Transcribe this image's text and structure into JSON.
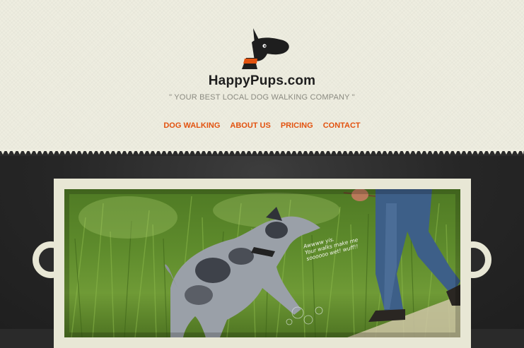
{
  "site": {
    "title": "HappyPups.com",
    "tagline": "\" YOUR BEST LOCAL DOG WALKING COMPANY \"",
    "logo_icon": "dog-head-icon"
  },
  "nav": {
    "items": [
      {
        "label": "DOG WALKING"
      },
      {
        "label": "ABOUT US"
      },
      {
        "label": "PRICING"
      },
      {
        "label": "CONTACT"
      }
    ]
  },
  "hero": {
    "caption_lines": [
      "Awwww yis.",
      "Your walks make me",
      "soooooo wet! wuff!!"
    ]
  },
  "colors": {
    "accent": "#e2520f",
    "header_bg": "#eeede0",
    "dark_bg": "#2a2a2a",
    "frame": "#e8e7d5"
  }
}
